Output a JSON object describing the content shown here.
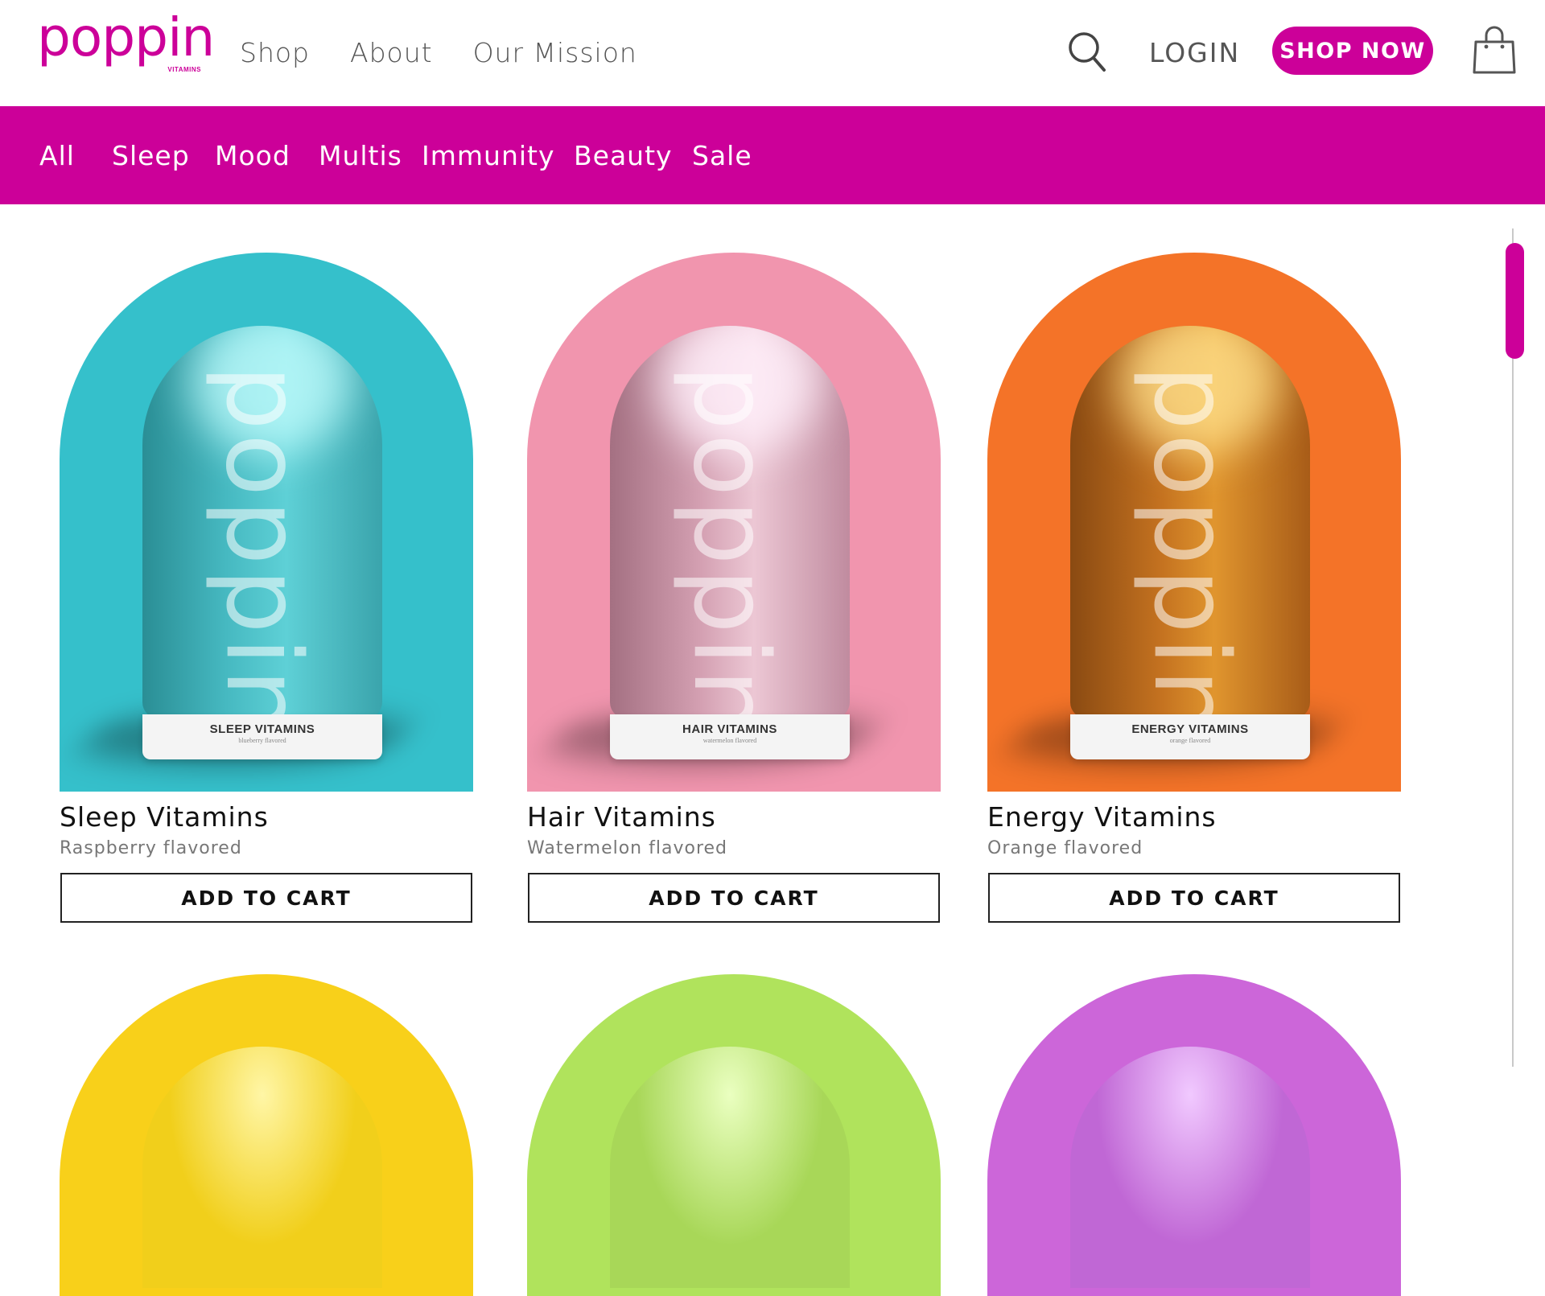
{
  "brand": {
    "logo_text": "poppin",
    "logo_sub": "VITAMINS",
    "color": "#cc0099"
  },
  "nav": {
    "items": [
      "Shop",
      "About",
      "Our Mission"
    ],
    "login": "LOGIN",
    "shop_now": "SHOP NOW",
    "search_icon": "search-icon",
    "bag_icon": "shopping-bag-icon"
  },
  "categories": [
    "All",
    "Sleep",
    "Mood",
    "Multis",
    "Immunity",
    "Beauty",
    "Sale"
  ],
  "products": [
    {
      "name": "Sleep Vitamins",
      "flavor": "Raspberry flavored",
      "bottle_word": "poppin",
      "bottle_label": "SLEEP VITAMINS",
      "bottle_sublabel": "blueberry flavored",
      "cta": "ADD TO CART",
      "arch_color": "#35c0cb",
      "bottle_color": "#3fbcc6"
    },
    {
      "name": "Hair Vitamins",
      "flavor": "Watermelon flavored",
      "bottle_word": "poppin",
      "bottle_label": "HAIR VITAMINS",
      "bottle_sublabel": "watermelon flavored",
      "cta": "ADD TO CART",
      "arch_color": "#f195ae",
      "bottle_color": "#d7a3b6"
    },
    {
      "name": "Energy Vitamins",
      "flavor": "Orange flavored",
      "bottle_word": "poppin",
      "bottle_label": "ENERGY VITAMINS",
      "bottle_sublabel": "orange flavored",
      "cta": "ADD TO CART",
      "arch_color": "#f47328",
      "bottle_color": "#c9731e"
    }
  ],
  "next_row_colors": [
    "#f8d01a",
    "#b0e35c",
    "#cc66d9"
  ],
  "accent": "#cc0099"
}
